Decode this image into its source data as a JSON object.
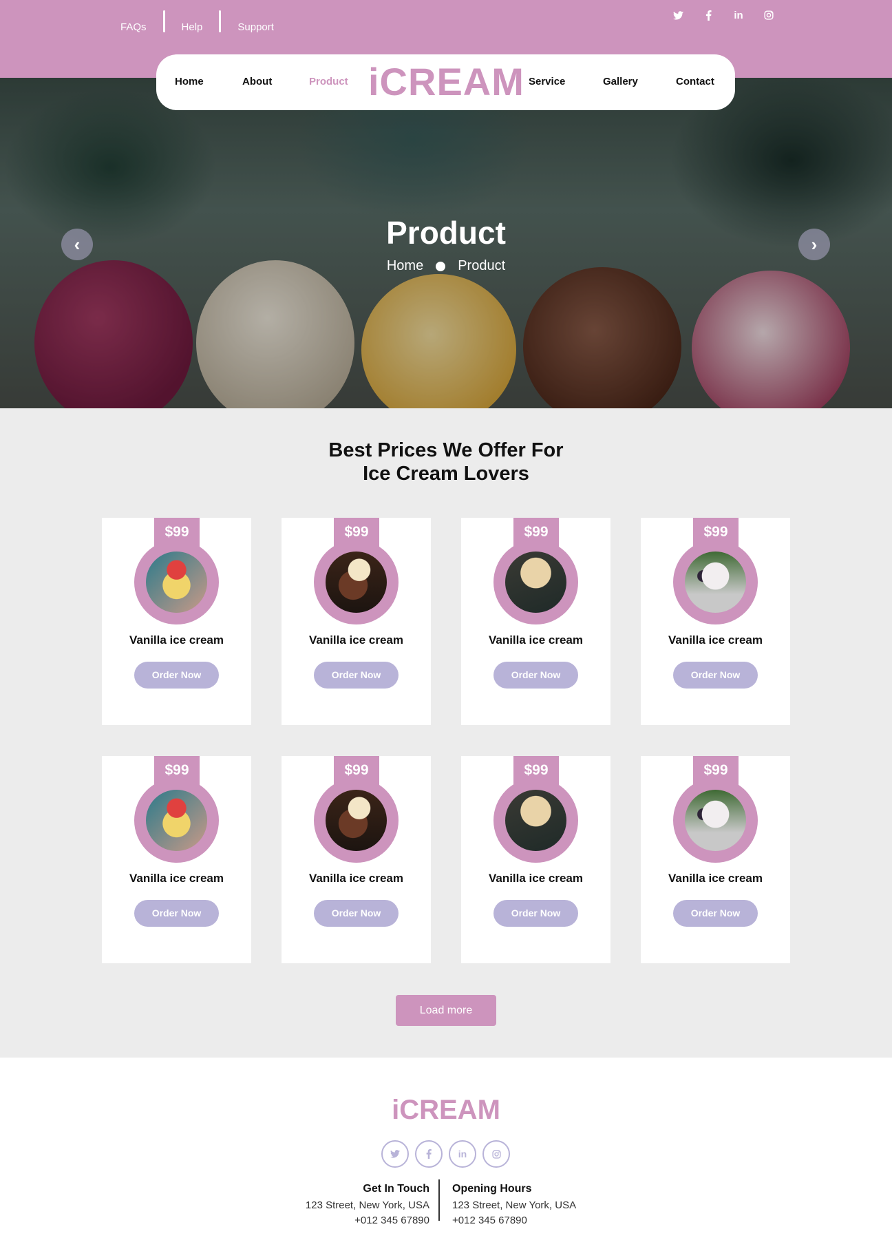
{
  "topbar": {
    "links": [
      "FAQs",
      "Help",
      "Support"
    ],
    "social_icons": [
      "twitter-icon",
      "facebook-icon",
      "linkedin-icon",
      "instagram-icon"
    ]
  },
  "nav": {
    "items": [
      "Home",
      "About",
      "Product",
      "Service",
      "Gallery",
      "Contact"
    ],
    "active": "Product",
    "logo": "iCREAM"
  },
  "hero": {
    "title": "Product",
    "breadcrumb_home": "Home",
    "breadcrumb_current": "Product"
  },
  "products": {
    "heading_line1": "Best Prices We Offer For",
    "heading_line2": "Ice Cream Lovers",
    "items": [
      {
        "price": "$99",
        "name": "Vanilla ice cream",
        "button": "Order Now"
      },
      {
        "price": "$99",
        "name": "Vanilla ice cream",
        "button": "Order Now"
      },
      {
        "price": "$99",
        "name": "Vanilla ice cream",
        "button": "Order Now"
      },
      {
        "price": "$99",
        "name": "Vanilla ice cream",
        "button": "Order Now"
      },
      {
        "price": "$99",
        "name": "Vanilla ice cream",
        "button": "Order Now"
      },
      {
        "price": "$99",
        "name": "Vanilla ice cream",
        "button": "Order Now"
      },
      {
        "price": "$99",
        "name": "Vanilla ice cream",
        "button": "Order Now"
      },
      {
        "price": "$99",
        "name": "Vanilla ice cream",
        "button": "Order Now"
      }
    ],
    "load_more": "Load more"
  },
  "footer": {
    "logo": "iCREAM",
    "get_in_touch": {
      "heading": "Get In Touch",
      "address": "123 Street, New York, USA",
      "phone": "+012 345 67890"
    },
    "opening_hours": {
      "heading": "Opening Hours",
      "address": "123 Street, New York, USA",
      "phone": "+012 345 67890"
    }
  },
  "colors": {
    "brand": "#cd94bd",
    "button": "#b8b3d8",
    "section_bg": "#ececec"
  }
}
